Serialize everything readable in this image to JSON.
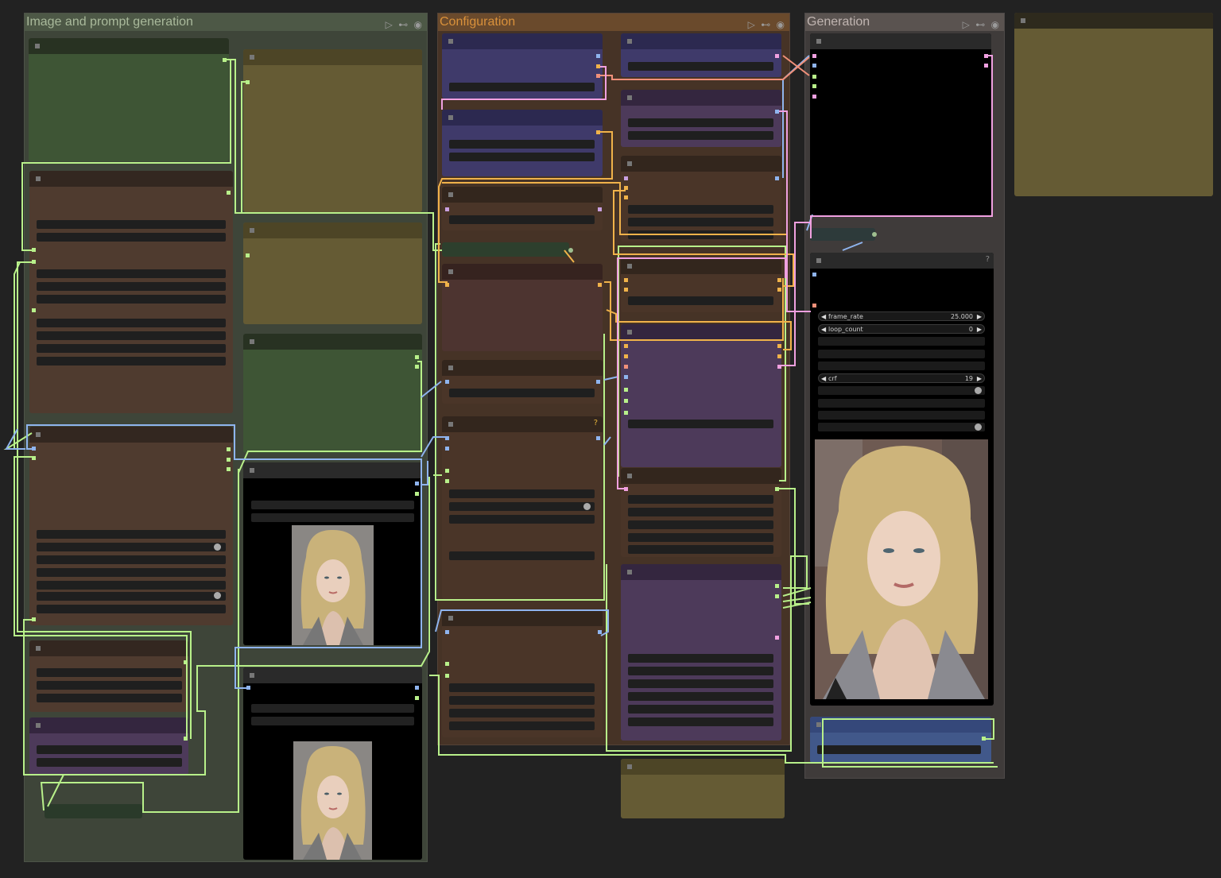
{
  "groups": {
    "image_prompt": {
      "title": "Image and prompt generation",
      "color": "#8fa37a"
    },
    "configuration": {
      "title": "Configuration",
      "color": "#c8842f"
    },
    "generation": {
      "title": "Generation",
      "color": "#b9a9a2"
    }
  },
  "group_controls": "▷ ⊷ ◉",
  "video_combine": {
    "widgets": [
      {
        "label": "frame_rate",
        "value": "25.000"
      },
      {
        "label": "loop_count",
        "value": "0"
      },
      {
        "label": "crf",
        "value": "19"
      }
    ],
    "help_icon": "?"
  },
  "config_help": "?",
  "colors": {
    "wire_green": "#b8f08a",
    "wire_blue": "#8fb4ee",
    "wire_orange": "#f0b24a",
    "wire_pink": "#f0a0e0",
    "wire_salmon": "#f0907a"
  }
}
